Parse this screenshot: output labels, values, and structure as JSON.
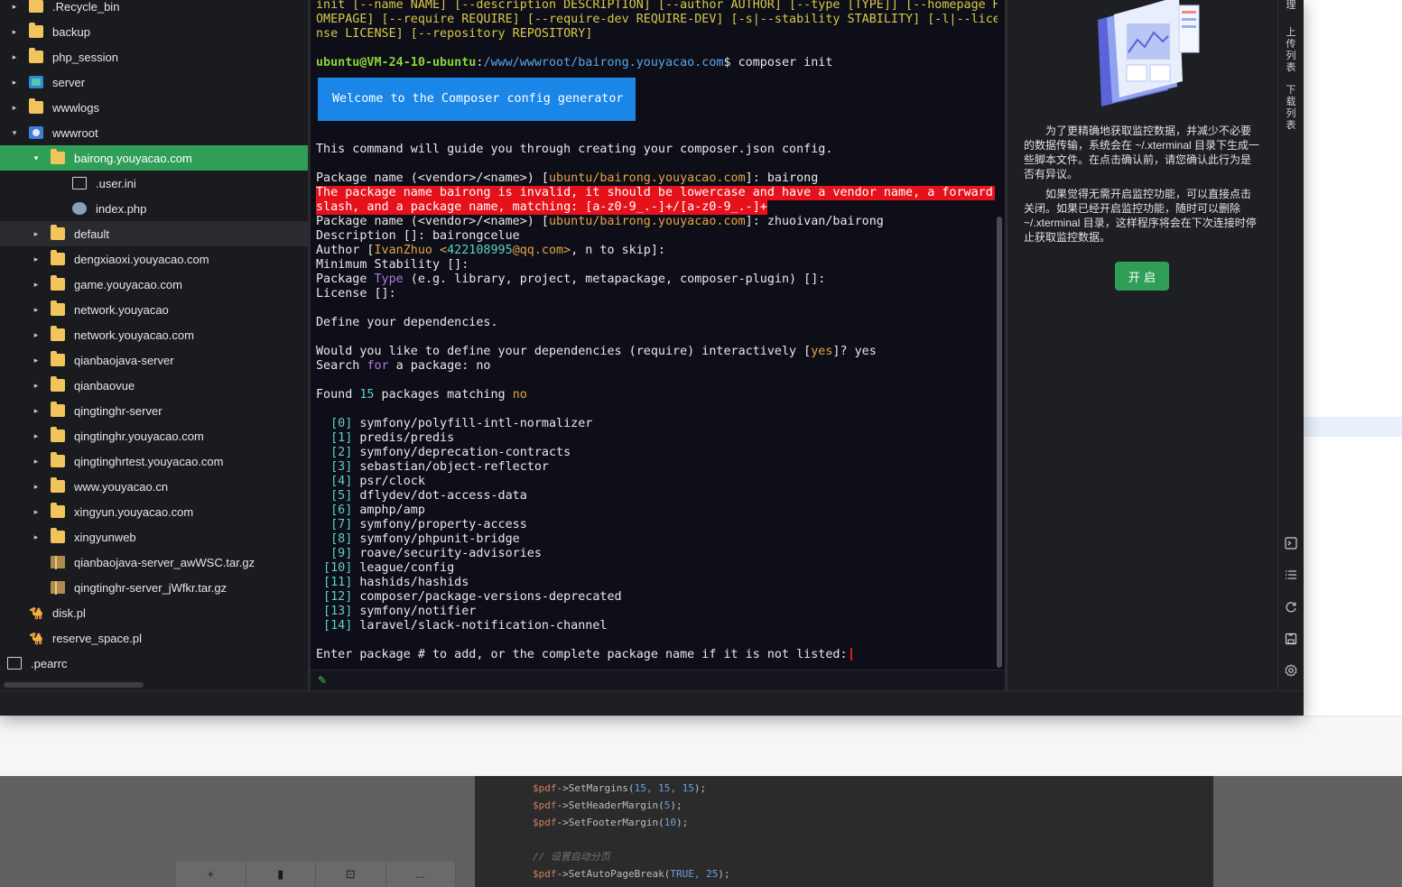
{
  "file_tree": {
    "items": [
      {
        "label": ".Recycle_bin",
        "type": "folder",
        "arrow": "▸"
      },
      {
        "label": "backup",
        "type": "folder",
        "arrow": "▸"
      },
      {
        "label": "php_session",
        "type": "folder",
        "arrow": "▸"
      },
      {
        "label": "server",
        "type": "server",
        "arrow": "▸"
      },
      {
        "label": "wwwlogs",
        "type": "folder",
        "arrow": "▸"
      },
      {
        "label": "wwwroot",
        "type": "web",
        "arrow": "▾"
      },
      {
        "label": "bairong.youyacao.com",
        "type": "folder",
        "arrow": "▾",
        "selected": true
      },
      {
        "label": ".user.ini",
        "type": "file",
        "arrow": ""
      },
      {
        "label": "index.php",
        "type": "php",
        "arrow": ""
      },
      {
        "label": "default",
        "type": "folder",
        "arrow": "▸",
        "hover": true
      },
      {
        "label": "dengxiaoxi.youyacao.com",
        "type": "folder",
        "arrow": "▸"
      },
      {
        "label": "game.youyacao.com",
        "type": "folder",
        "arrow": "▸"
      },
      {
        "label": "network.youyacao",
        "type": "folder",
        "arrow": "▸"
      },
      {
        "label": "network.youyacao.com",
        "type": "folder",
        "arrow": "▸"
      },
      {
        "label": "qianbaojava-server",
        "type": "folder",
        "arrow": "▸"
      },
      {
        "label": "qianbaovue",
        "type": "folder",
        "arrow": "▸"
      },
      {
        "label": "qingtinghr-server",
        "type": "folder",
        "arrow": "▸"
      },
      {
        "label": "qingtinghr.youyacao.com",
        "type": "folder",
        "arrow": "▸"
      },
      {
        "label": "qingtinghrtest.youyacao.com",
        "type": "folder",
        "arrow": "▸"
      },
      {
        "label": "www.youyacao.cn",
        "type": "folder",
        "arrow": "▸"
      },
      {
        "label": "xingyun.youyacao.com",
        "type": "folder",
        "arrow": "▸"
      },
      {
        "label": "xingyunweb",
        "type": "folder",
        "arrow": "▸"
      },
      {
        "label": "qianbaojava-server_awWSC.tar.gz",
        "type": "archive",
        "arrow": ""
      },
      {
        "label": "qingtinghr-server_jWfkr.tar.gz",
        "type": "archive",
        "arrow": ""
      },
      {
        "label": "disk.pl",
        "type": "perl",
        "arrow": ""
      },
      {
        "label": "reserve_space.pl",
        "type": "perl",
        "arrow": ""
      },
      {
        "label": ".pearrc",
        "type": "file",
        "arrow": ""
      }
    ]
  },
  "terminal": {
    "usage_line_1": "init [--name NAME] [--description DESCRIPTION] [--author AUTHOR] [--type [TYPE]] [--homepage H",
    "usage_line_2": "OMEPAGE] [--require REQUIRE] [--require-dev REQUIRE-DEV] [-s|--stability STABILITY] [-l|--lice",
    "usage_line_3": "nse LICENSE] [--repository REPOSITORY]",
    "prompt_user": "ubuntu@VM-24-10-ubuntu",
    "prompt_sep": ":",
    "prompt_path": "/www/wwwroot/bairong.youyacao.com",
    "prompt_command": "$ composer init",
    "welcome": "Welcome to the Composer config generator",
    "guide": "This command will guide you through creating your composer.json config.",
    "pkg_q": "Package name (<vendor>/<name>) [",
    "pkg_default": "ubuntu/bairong.youyacao.com",
    "pkg_answer_1": "]: bairong",
    "error_1": "The package name bairong is invalid, it should be lowercase and have a vendor name, a forward",
    "error_2": "slash, and a package name, matching: [a-z0-9_.-]+/[a-z0-9_.-]+",
    "pkg_answer_2": "]: zhuoivan/bairong",
    "description": "Description []: bairongcelue",
    "author_pre": "Author [",
    "author_name": "IvanZhuo",
    "author_lt": " <",
    "author_num": "422108995",
    "author_mail": "@qq.com>",
    "author_post": ", n to skip]:",
    "min_stability": "Minimum Stability []:",
    "ptype_pre": "Package ",
    "ptype_word": "Type",
    "ptype_post": " (e.g. library, project, metapackage, composer-plugin) []:",
    "license": "License []:",
    "define_deps": "Define your dependencies.",
    "would_pre": "Would you like to define your dependencies (require) interactively [",
    "would_yes": "yes",
    "would_post": "]? yes",
    "search_pre": "Search ",
    "search_for": "for",
    "search_post": " a package: no",
    "found_pre": "Found ",
    "found_count": "15",
    "found_mid": " packages matching ",
    "found_term": "no",
    "packages": [
      {
        "idx": "  [0]",
        "name": "symfony/polyfill-intl-normalizer"
      },
      {
        "idx": "  [1]",
        "name": "predis/predis"
      },
      {
        "idx": "  [2]",
        "name": "symfony/deprecation-contracts"
      },
      {
        "idx": "  [3]",
        "name": "sebastian/object-reflector"
      },
      {
        "idx": "  [4]",
        "name": "psr/clock"
      },
      {
        "idx": "  [5]",
        "name": "dflydev/dot-access-data"
      },
      {
        "idx": "  [6]",
        "name": "amphp/amp"
      },
      {
        "idx": "  [7]",
        "name": "symfony/property-access"
      },
      {
        "idx": "  [8]",
        "name": "symfony/phpunit-bridge"
      },
      {
        "idx": "  [9]",
        "name": "roave/security-advisories"
      },
      {
        "idx": " [10]",
        "name": "league/config"
      },
      {
        "idx": " [11]",
        "name": "hashids/hashids"
      },
      {
        "idx": " [12]",
        "name": "composer/package-versions-deprecated"
      },
      {
        "idx": " [13]",
        "name": "symfony/notifier"
      },
      {
        "idx": " [14]",
        "name": "laravel/slack-notification-channel"
      }
    ],
    "enter_prompt": "Enter package # to add, or the complete package name if it is not listed:"
  },
  "info_panel": {
    "para_1": "为了更精确地获取监控数据，并减少不必要的数据传输，系统会在 ~/.xterminal 目录下生成一些脚本文件。在点击确认前，请您确认此行为是否有异议。",
    "para_2": "如果觉得无需开启监控功能，可以直接点击关闭。如果已经开启监控功能，随时可以删除 ~/.xterminal 目录，这样程序将会在下次连接时停止获取监控数据。",
    "enable_button": "开 启"
  },
  "right_toolbar": {
    "tab_top": "理",
    "tab_upload": "上传列表",
    "tab_download": "下载列表",
    "icons": [
      "terminal-icon",
      "list-icon",
      "refresh-icon",
      "save-icon",
      "settings-icon"
    ]
  },
  "background": {
    "code_lines": [
      {
        "pre": "$pdf",
        "call": "->SetMargins(",
        "args": "15, 15, 15",
        "post": ");"
      },
      {
        "pre": "$pdf",
        "call": "->SetHeaderMargin(",
        "args": "5",
        "post": ");"
      },
      {
        "pre": "$pdf",
        "call": "->SetFooterMargin(",
        "args": "10",
        "post": ");"
      },
      {
        "pre": "",
        "call": "",
        "args": "",
        "post": ""
      },
      {
        "comment": "// 设置自动分页"
      },
      {
        "pre": "$pdf",
        "call": "->SetAutoPageBreak(",
        "args": "TRUE, 25",
        "post": ");"
      }
    ],
    "toolbar_icons": [
      "+",
      "▮",
      "⊡",
      "..."
    ]
  },
  "colors": {
    "accent_green": "#2f9f57",
    "banner_blue": "#1a86e8",
    "error_red": "#e5121c",
    "terminal_bg": "#0d0e17"
  }
}
